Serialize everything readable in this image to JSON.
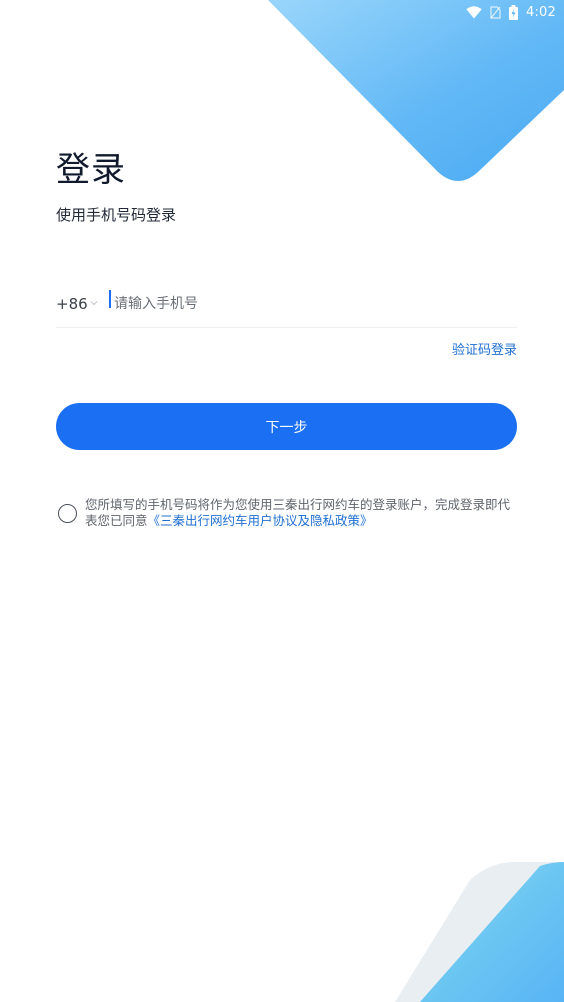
{
  "status_bar": {
    "time": "4:02"
  },
  "login": {
    "title": "登录",
    "subtitle": "使用手机号码登录",
    "country_code": "+86",
    "phone_placeholder": "请输入手机号",
    "sms_login_label": "验证码登录",
    "next_button_label": "下一步",
    "agreement_text": "您所填写的手机号码将作为您使用三秦出行网约车的登录账户，完成登录即代表您已同意",
    "agreement_link": "《三秦出行网约车用户协议及隐私政策》"
  },
  "colors": {
    "primary": "#1a6ff2",
    "link": "#1f6fd1",
    "title": "#111a2c",
    "decor_blue": "#5cb8f7"
  },
  "icons": [
    "wifi-icon",
    "sim-card-icon",
    "battery-icon",
    "chevron-down-icon",
    "radio-unchecked-icon"
  ]
}
